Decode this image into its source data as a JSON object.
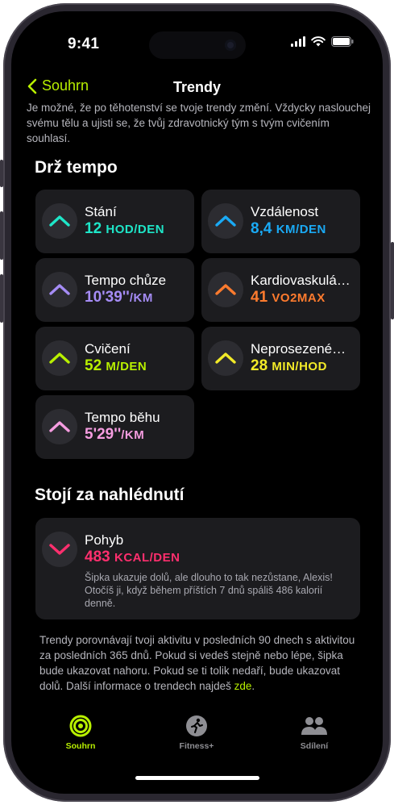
{
  "status": {
    "time": "9:41"
  },
  "nav": {
    "back_label": "Souhrn",
    "title": "Trendy"
  },
  "intro": "Je možné, že po těhotenství se tvoje trendy změní. Vždycky naslouchej svému tělu a ujisti se, že tvůj zdravotnický tým s tvým cvičením souhlasí.",
  "sections": {
    "keep_pace": "Drž tempo",
    "worth_a_look": "Stojí za nahlédnutí"
  },
  "trends": [
    {
      "title": "Stání",
      "value": "12",
      "unit": "HOD/DEN",
      "color": "#1ee6c8",
      "direction": "up"
    },
    {
      "title": "Vzdálenost",
      "value": "8,4",
      "unit": "KM/DEN",
      "color": "#1aaaf5",
      "direction": "up"
    },
    {
      "title": "Tempo chůze",
      "value": "10'39''",
      "unit": "/KM",
      "color": "#a58cf5",
      "direction": "up"
    },
    {
      "title": "Kardiovaskulá…",
      "value": "41",
      "unit": "VO2MAX",
      "color": "#ff7b2e",
      "direction": "up"
    },
    {
      "title": "Cvičení",
      "value": "52",
      "unit": "M/DEN",
      "color": "#b8f000",
      "direction": "up"
    },
    {
      "title": "Neprosezené…",
      "value": "28",
      "unit": "MIN/HOD",
      "color": "#f2ea28",
      "direction": "up"
    },
    {
      "title": "Tempo běhu",
      "value": "5'29''",
      "unit": "/KM",
      "color": "#f59ce0",
      "direction": "up"
    }
  ],
  "highlight": {
    "title": "Pohyb",
    "value": "483",
    "unit": "KCAL/DEN",
    "color": "#ff2f6e",
    "direction": "down",
    "description": "Šipka ukazuje dolů, ale dlouho to tak nezůstane, Alexis! Otočíš ji, když během příštích 7 dnů spáliš 486 kalorií denně."
  },
  "footer": {
    "text": "Trendy porovnávají tvoji aktivitu v posledních 90 dnech s aktivitou za posledních 365 dnů. Pokud si vedeš stejně nebo lépe, šipka bude ukazovat nahoru. Pokud se ti tolik nedaří, bude ukazovat dolů. Další informace o trendech najdeš ",
    "link": "zde",
    "end": "."
  },
  "tabs": [
    {
      "label": "Souhrn",
      "icon": "activity-rings-icon",
      "active": true
    },
    {
      "label": "Fitness+",
      "icon": "running-figure-icon",
      "active": false
    },
    {
      "label": "Sdílení",
      "icon": "people-icon",
      "active": false
    }
  ],
  "colors": {
    "accent": "#b8f000",
    "card": "#1c1c1f",
    "muted_text": "#b6b6bd"
  }
}
